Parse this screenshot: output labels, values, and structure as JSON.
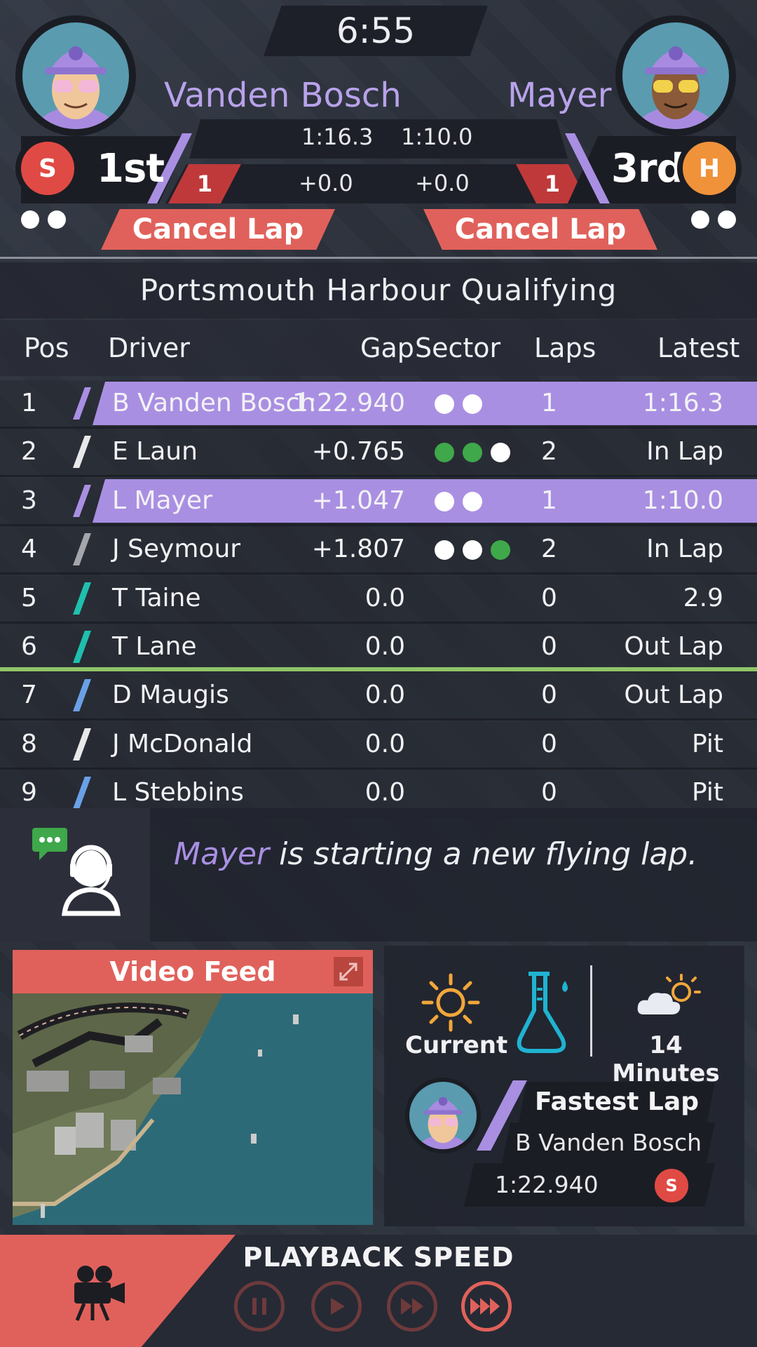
{
  "header": {
    "timer": "6:55",
    "left_driver": {
      "name": "Vanden Bosch",
      "position": "1st",
      "tyre": "S",
      "best_time": "1:16.3",
      "delta": "+0.0",
      "lap": "1",
      "cancel_label": "Cancel Lap",
      "dots": 2
    },
    "right_driver": {
      "name": "Mayer",
      "position": "3rd",
      "tyre": "H",
      "best_time": "1:10.0",
      "delta": "+0.0",
      "lap": "1",
      "cancel_label": "Cancel Lap",
      "dots": 2
    }
  },
  "session": {
    "title": "Portsmouth Harbour Qualifying"
  },
  "table": {
    "headers": {
      "pos": "Pos",
      "driver": "Driver",
      "gap": "Gap",
      "sector": "Sector",
      "laps": "Laps",
      "latest": "Latest"
    },
    "rows": [
      {
        "pos": "1",
        "driver": "B Vanden Bosch",
        "gap": "1:22.940",
        "sectors": [
          "white",
          "white"
        ],
        "laps": "1",
        "latest": "1:16.3",
        "highlight": true,
        "team_color": "#a98fe2"
      },
      {
        "pos": "2",
        "driver": "E Laun",
        "gap": "+0.765",
        "sectors": [
          "green",
          "green",
          "white"
        ],
        "laps": "2",
        "latest": "In Lap",
        "highlight": false,
        "team_color": "#e8e8ea"
      },
      {
        "pos": "3",
        "driver": "L Mayer",
        "gap": "+1.047",
        "sectors": [
          "white",
          "white"
        ],
        "laps": "1",
        "latest": "1:10.0",
        "highlight": true,
        "team_color": "#a98fe2"
      },
      {
        "pos": "4",
        "driver": "J Seymour",
        "gap": "+1.807",
        "sectors": [
          "white",
          "white",
          "green"
        ],
        "laps": "2",
        "latest": "In Lap",
        "highlight": false,
        "team_color": "#a4a6ab"
      },
      {
        "pos": "5",
        "driver": "T Taine",
        "gap": "0.0",
        "sectors": [],
        "laps": "0",
        "latest": "2.9",
        "highlight": false,
        "team_color": "#1fbfae"
      },
      {
        "pos": "6",
        "driver": "T Lane",
        "gap": "0.0",
        "sectors": [],
        "laps": "0",
        "latest": "Out Lap",
        "highlight": false,
        "team_color": "#1fbfae"
      },
      {
        "pos": "7",
        "driver": "D Maugis",
        "gap": "0.0",
        "sectors": [],
        "laps": "0",
        "latest": "Out Lap",
        "highlight": false,
        "team_color": "#6aa0e6"
      },
      {
        "pos": "8",
        "driver": "J McDonald",
        "gap": "0.0",
        "sectors": [],
        "laps": "0",
        "latest": "Pit",
        "highlight": false,
        "team_color": "#e8e8ea"
      },
      {
        "pos": "9",
        "driver": "L Stebbins",
        "gap": "0.0",
        "sectors": [],
        "laps": "0",
        "latest": "Pit",
        "highlight": false,
        "team_color": "#6aa0e6"
      }
    ]
  },
  "message": {
    "name": "Mayer",
    "text": " is starting a new flying lap."
  },
  "video": {
    "title": "Video Feed"
  },
  "weather": {
    "current_label": "Current",
    "forecast_label": "14 Minutes"
  },
  "fastest_lap": {
    "title": "Fastest Lap",
    "driver": "B Vanden Bosch",
    "time": "1:22.940",
    "tyre": "S"
  },
  "playback": {
    "title": "PLAYBACK SPEED",
    "active_index": 3
  },
  "colors": {
    "purple": "#a98fe2",
    "coral": "#e0615b",
    "soft_tyre": "#e04a44",
    "hard_tyre": "#f0923a",
    "sector_green": "#3ea84a",
    "cutoff_green": "#8fc46a"
  }
}
